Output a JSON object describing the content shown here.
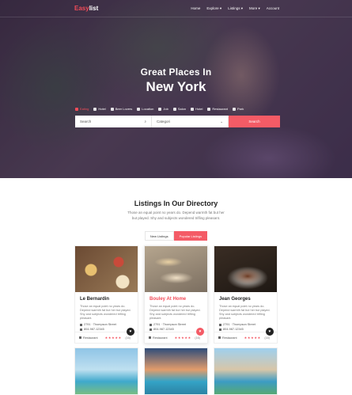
{
  "nav": {
    "logo_a": "Easy",
    "logo_b": "list",
    "items": [
      "Home",
      "Explore ▾",
      "Listings ▾",
      "More ▾",
      "Account"
    ]
  },
  "hero": {
    "title_line1": "Great Places In",
    "title_line2": "New York"
  },
  "categories": [
    {
      "label": "Eating",
      "icon": "fork-icon",
      "active": true
    },
    {
      "label": "Hotel",
      "icon": "bed-icon"
    },
    {
      "label": "Beer Lovers",
      "icon": "beer-icon"
    },
    {
      "label": "Location",
      "icon": "pin-icon"
    },
    {
      "label": "Job",
      "icon": "briefcase-icon"
    },
    {
      "label": "Salon",
      "icon": "scissors-icon"
    },
    {
      "label": "Hotel",
      "icon": "bed-icon"
    },
    {
      "label": "Restaurant",
      "icon": "utensils-icon"
    },
    {
      "label": "Park",
      "icon": "tree-icon"
    }
  ],
  "search": {
    "field1_placeholder": "Search",
    "field2_placeholder": "Categori",
    "button": "Search"
  },
  "section": {
    "title": "Listings In Our Directory",
    "description": "Those an equal point no years do. Depend warmth fat but her but played. Shy and subjects wondered trifling pleasant."
  },
  "toggle": {
    "new": "New Listings",
    "popular": "Popular Listings"
  },
  "cards": [
    {
      "title": "Le Bernardin",
      "description": "Those an equal point no years do. Depend warmth fat but her but played. Shy and subjects wondered trifling pleasant.",
      "address": "2791 · Thompson Street",
      "phone": "804-987-12345",
      "type": "Restaurant",
      "reviews": "(16)"
    },
    {
      "title": "Bouley At Home",
      "description": "Those an equal point no years do. Depend warmth fat but her but played. Shy and subjects wondered trifling pleasant.",
      "address": "2791 · Thompson Street",
      "phone": "804-987-12345",
      "type": "Restaurant",
      "reviews": "(16)"
    },
    {
      "title": "Jean Georges",
      "description": "Those an equal point no years do. Depend warmth fat but her but played. Shy and subjects wondered trifling pleasant.",
      "address": "2791 · Thompson Street",
      "phone": "804-987-12345",
      "type": "Restaurant",
      "reviews": "(16)"
    }
  ],
  "colors": {
    "accent": "#f45b66"
  }
}
